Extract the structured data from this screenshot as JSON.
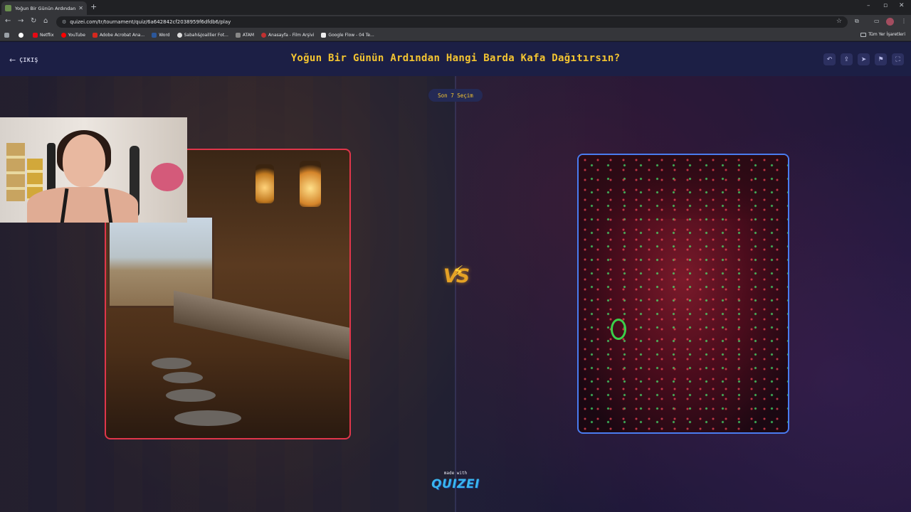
{
  "browser": {
    "tab_title": "Yoğun Bir Günün Ardından Hangi",
    "url": "quizei.com/tr/tournament/quiz/6a642842cf2038959f6dfdb6/play",
    "bookmarks": [
      {
        "label": "Netflix",
        "color": "#e50914"
      },
      {
        "label": "YouTube",
        "color": "#ff0000"
      },
      {
        "label": "Adobe Acrobat Ana...",
        "color": "#d4281e"
      },
      {
        "label": "Word",
        "color": "#2b579a"
      },
      {
        "label": "Sabah&Joaillier Fot...",
        "color": "#dddddd"
      },
      {
        "label": "ATAM",
        "color": "#888888"
      },
      {
        "label": "Anasayfa - Film Arşivi",
        "color": "#c03030"
      },
      {
        "label": "Google Flow - 04 Te...",
        "color": "#eeeeee"
      }
    ],
    "bookmarks_other": "Tüm Yer İşaretleri"
  },
  "header": {
    "exit_label": "ÇIKIŞ",
    "title": "Yoğun Bir Günün Ardından Hangi Barda Kafa Dağıtırsın?"
  },
  "round": {
    "label": "Son 7 Seçim"
  },
  "versus": {
    "label": "VS"
  },
  "footer": {
    "made_with": "made with",
    "brand": "QUIZEI"
  },
  "colors": {
    "accent": "#f4c531",
    "left_card_border": "#e0364a",
    "right_card_border": "#4a7cf0",
    "header_bg": "#1c1f45"
  }
}
